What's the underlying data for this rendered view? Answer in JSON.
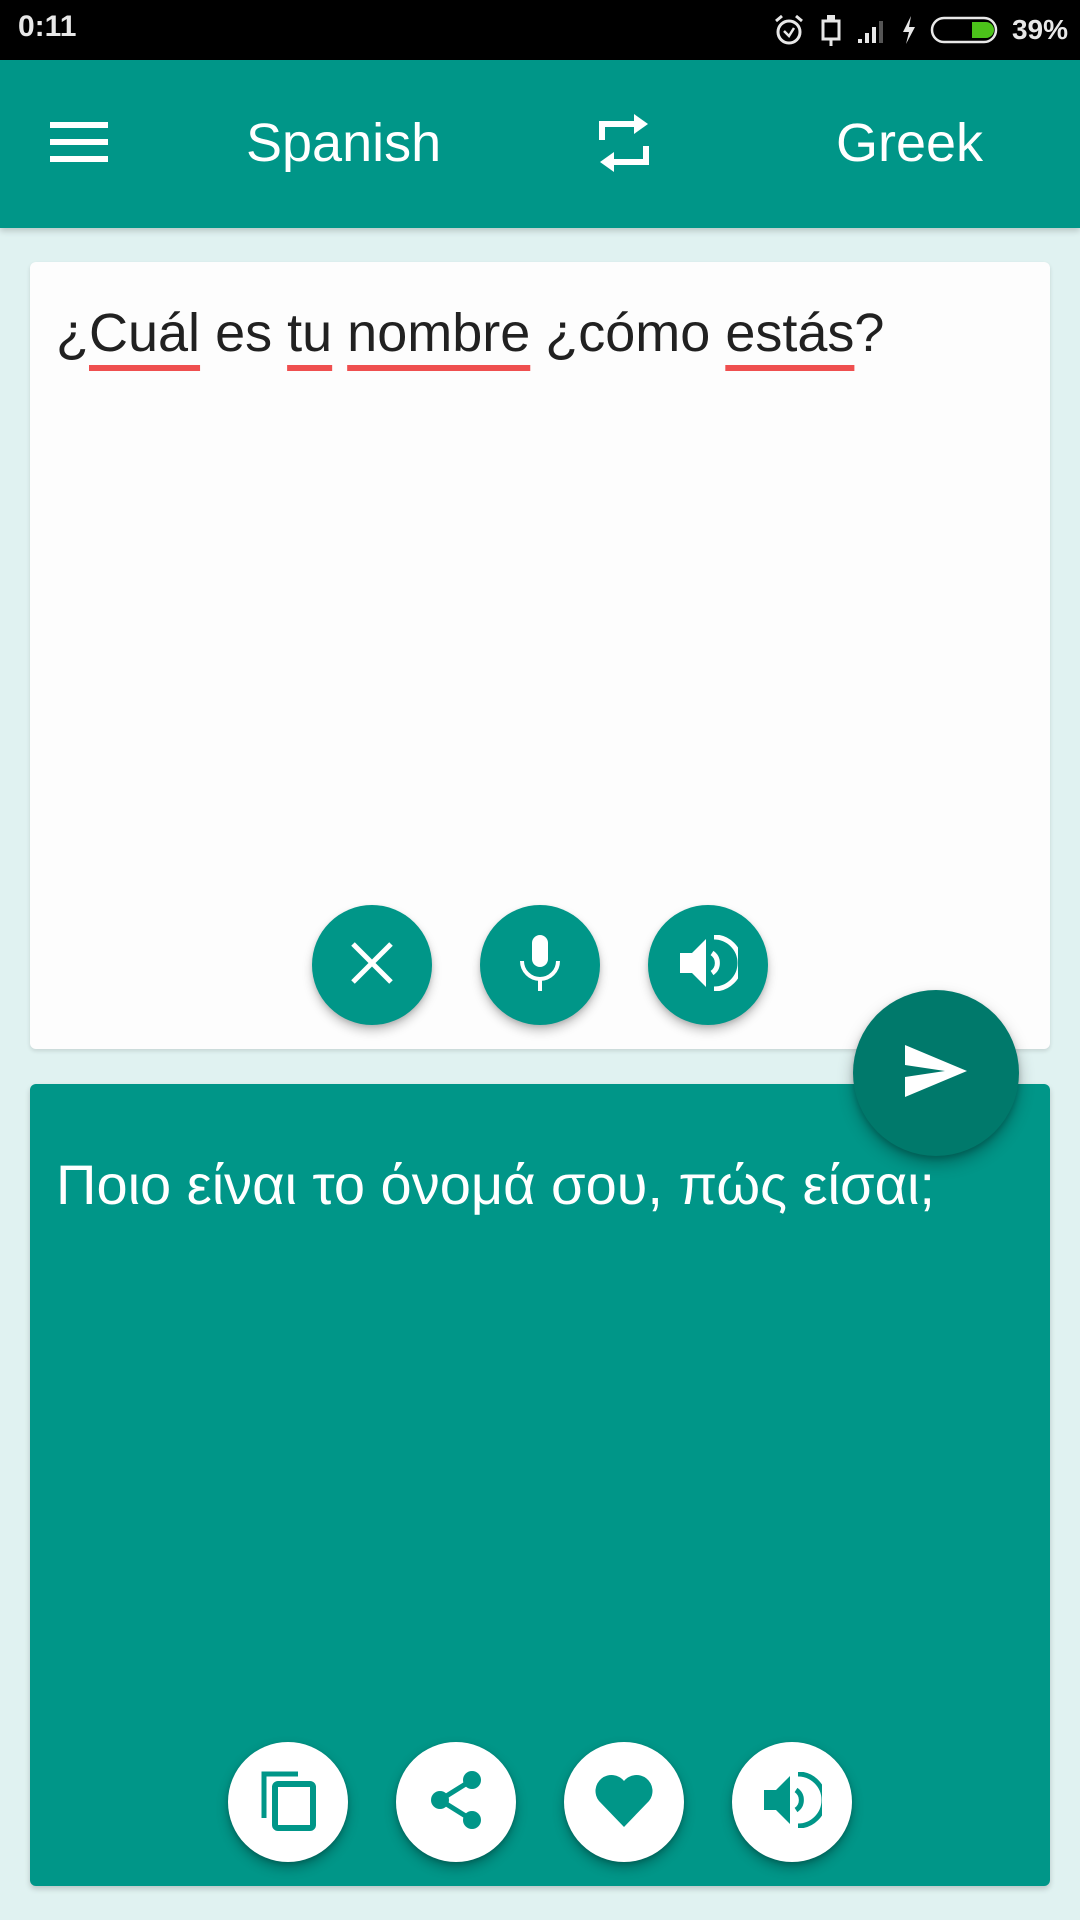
{
  "status_bar": {
    "time": "0:11",
    "battery_percent": "39%",
    "battery_level": 0.39,
    "icons": [
      "alarm-icon",
      "usb-icon",
      "signal-icon",
      "charging-icon",
      "battery-icon"
    ]
  },
  "app_bar": {
    "menu_icon": "hamburger-menu-icon",
    "source_language": "Spanish",
    "swap_icon": "swap-languages-icon",
    "target_language": "Greek"
  },
  "input": {
    "words": [
      {
        "text": "¿",
        "misspelled": false
      },
      {
        "text": "Cuál",
        "misspelled": true
      },
      {
        "text": " es ",
        "misspelled": false
      },
      {
        "text": "tu",
        "misspelled": true
      },
      {
        "text": " ",
        "misspelled": false
      },
      {
        "text": "nombre",
        "misspelled": true
      },
      {
        "text": " ¿cómo ",
        "misspelled": false
      },
      {
        "text": "estás",
        "misspelled": true
      },
      {
        "text": "?",
        "misspelled": false
      }
    ],
    "full_text": "¿Cuál es tu nombre ¿cómo estás?",
    "actions": [
      {
        "name": "clear-button",
        "icon": "close-icon"
      },
      {
        "name": "microphone-button",
        "icon": "microphone-icon"
      },
      {
        "name": "speak-source-button",
        "icon": "speaker-icon"
      }
    ]
  },
  "send": {
    "icon": "send-icon"
  },
  "output": {
    "text": "Ποιο είναι το όνομά σου, πώς είσαι;",
    "actions": [
      {
        "name": "copy-button",
        "icon": "copy-icon"
      },
      {
        "name": "share-button",
        "icon": "share-icon"
      },
      {
        "name": "favorite-button",
        "icon": "heart-icon"
      },
      {
        "name": "speak-translation-button",
        "icon": "speaker-icon"
      }
    ]
  },
  "colors": {
    "primary": "#009688",
    "primary_dark": "#00796b",
    "background": "#e0f2f1",
    "spell_underline": "#ef4f4f",
    "battery_fill": "#4cc21a"
  }
}
